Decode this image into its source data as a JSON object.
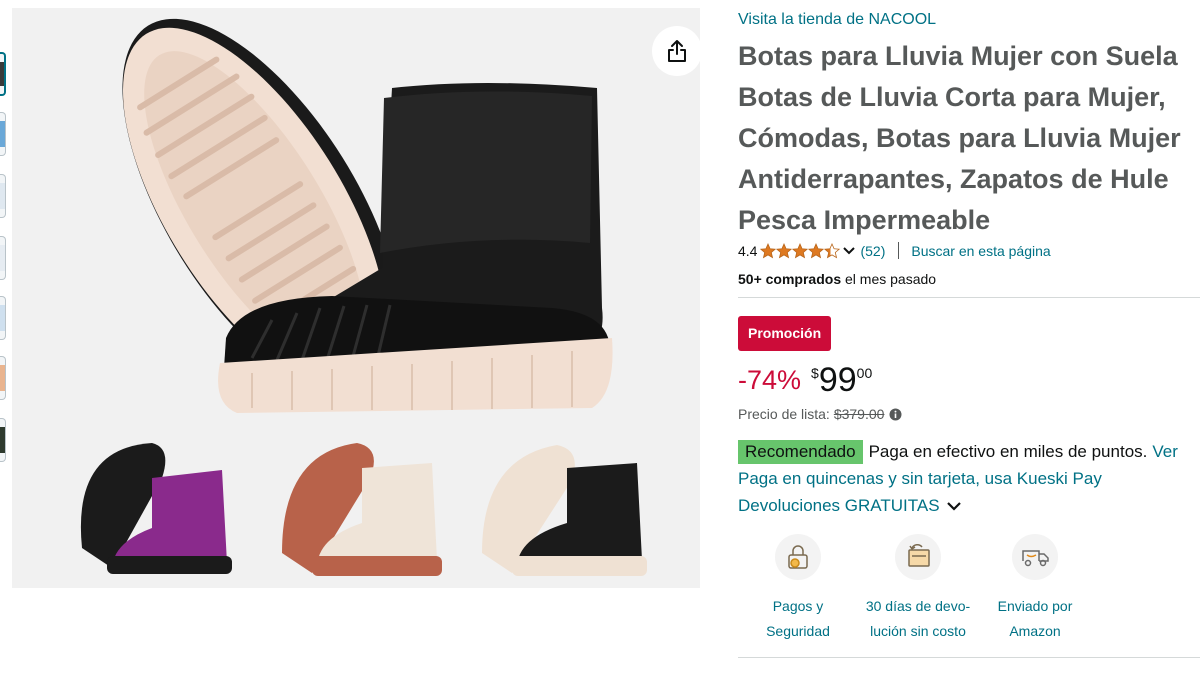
{
  "store": {
    "link": "Visita la tienda de NACOOL"
  },
  "product": {
    "title_lines": [
      "Botas para Lluvia Mujer con Suela",
      "Botas de Lluvia Corta para Mujer,",
      "Cómodas, Botas para Lluvia Mujer",
      "Antiderrapantes, Zapatos de Hule",
      "Pesca Impermeable"
    ]
  },
  "rating": {
    "value": "4.4",
    "stars": 4.4,
    "count": "(52)",
    "search_link": "Buscar en esta página"
  },
  "bought": {
    "bold": "50+ comprados",
    "rest": " el mes pasado"
  },
  "promo": {
    "label": "Promoción"
  },
  "price": {
    "discount": "-74%",
    "symbol": "$",
    "whole": "99",
    "fraction": "00"
  },
  "list_price": {
    "label": "Precio de lista:",
    "value": "$379.00"
  },
  "recommended": {
    "badge": "Recomendado",
    "text": "Paga en efectivo en miles de puntos.",
    "link": "Ver"
  },
  "kueski": {
    "text": "Paga en quincenas y sin tarjeta, usa Kueski Pay"
  },
  "returns": {
    "text": "Devoluciones GRATUITAS"
  },
  "features": [
    {
      "icon": "secure-payment-icon",
      "line1": "Pagos y",
      "line2": "Seguridad"
    },
    {
      "icon": "returns-30-days-icon",
      "line1": "30 días de devo-",
      "line2": "lución sin costo"
    },
    {
      "icon": "amazon-delivery-truck-icon",
      "line1": "Enviado por",
      "line2": "Amazon"
    }
  ],
  "colors": {
    "link": "#007185",
    "deal_red": "#cc0c39",
    "star": "#de7921",
    "recommended_green": "#67c56c"
  },
  "icons": {
    "share": "share-icon",
    "chevron": "chevron-down-icon",
    "info": "info-icon"
  }
}
